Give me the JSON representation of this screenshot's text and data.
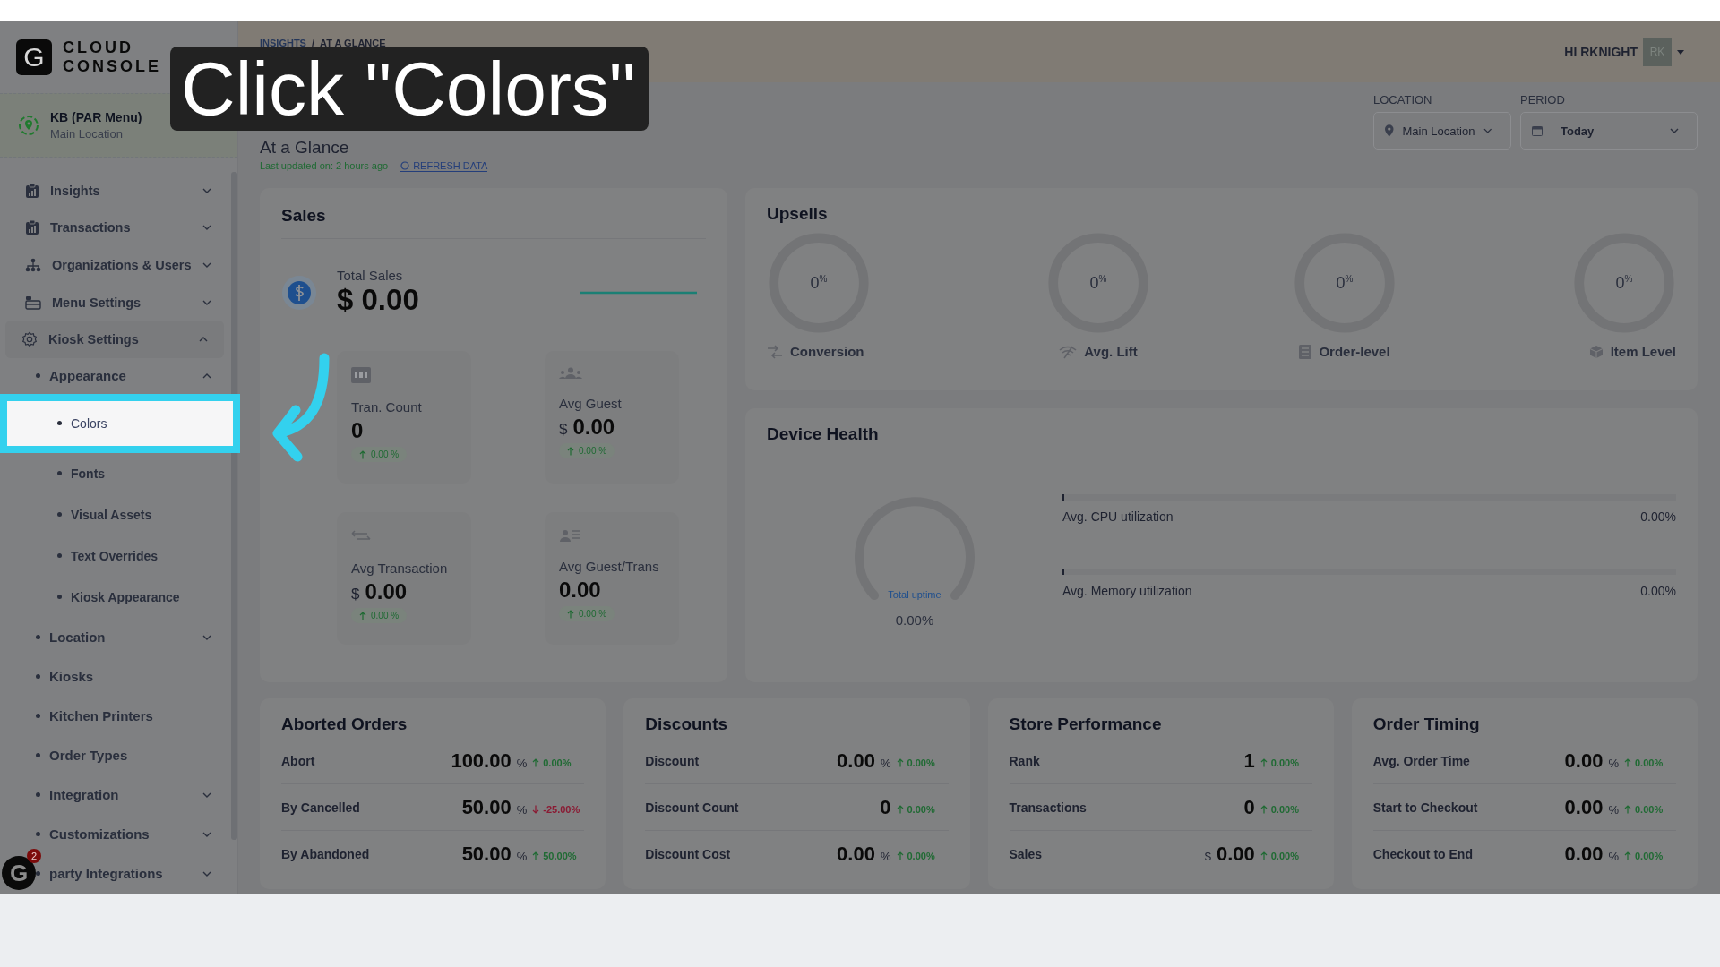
{
  "caption": "Click \"Colors\"",
  "brand": {
    "line1": "CLOUD",
    "line2": "CONSOLE",
    "letter": "G"
  },
  "location_card": {
    "name": "KB (PAR Menu)",
    "subtitle": "Main Location"
  },
  "sidebar": {
    "items": [
      {
        "label": "Insights",
        "expanded": false,
        "selected": false
      },
      {
        "label": "Transactions",
        "expanded": false,
        "selected": false
      },
      {
        "label": "Organizations & Users",
        "expanded": false,
        "selected": false
      },
      {
        "label": "Menu Settings",
        "expanded": false,
        "selected": false
      },
      {
        "label": "Kiosk Settings",
        "expanded": true,
        "selected": false,
        "children": [
          {
            "label": "Appearance",
            "kind": "group",
            "expanded": true,
            "selected": false,
            "children": [
              {
                "label": "Colors",
                "selected": true
              },
              {
                "label": "Fonts",
                "selected": false
              },
              {
                "label": "Visual Assets",
                "selected": false
              },
              {
                "label": "Text Overrides",
                "selected": false
              },
              {
                "label": "Kiosk Appearance",
                "selected": false
              }
            ]
          },
          {
            "label": "Location",
            "kind": "group",
            "expanded": false,
            "selected": false
          },
          {
            "label": "Kiosks",
            "kind": "link",
            "expanded": false,
            "selected": false
          },
          {
            "label": "Kitchen Printers",
            "kind": "link",
            "expanded": false,
            "selected": false
          },
          {
            "label": "Order Types",
            "kind": "link",
            "expanded": false,
            "selected": false
          },
          {
            "label": "Integration",
            "kind": "group",
            "expanded": false,
            "selected": false
          },
          {
            "label": "Customizations",
            "kind": "group",
            "expanded": false,
            "selected": false
          },
          {
            "label": "party Integrations",
            "kind": "group",
            "expanded": false,
            "selected": false
          }
        ]
      }
    ]
  },
  "chat_button": {
    "letter": "G",
    "badge": "2"
  },
  "breadcrumb": {
    "separator": "/",
    "items": [
      "INSIGHTS",
      "AT A GLANCE"
    ]
  },
  "user": {
    "greeting": "HI RKNIGHT",
    "initials": "RK"
  },
  "page": {
    "title": "At a Glance",
    "updated": "Last updated on: 2 hours ago",
    "refresh": "REFRESH DATA"
  },
  "filters": [
    {
      "label": "LOCATION",
      "value": "Main Location"
    },
    {
      "label": "PERIOD",
      "value": "Today"
    }
  ],
  "sales": {
    "title": "Sales",
    "total_label": "Total Sales",
    "total_value": "$ 0.00",
    "metrics": [
      {
        "label": "Tran. Count",
        "value": "0",
        "change": "0.00 %"
      },
      {
        "label": "Avg Guest",
        "prefix": "$",
        "value": "0.00",
        "change": "0.00 %"
      },
      {
        "label": "Avg Transaction",
        "prefix": "$",
        "value": "0.00",
        "change": "0.00 %"
      },
      {
        "label": "Avg Guest/Trans",
        "value": "0.00",
        "change": "0.00 %"
      }
    ]
  },
  "upsells": {
    "title": "Upsells",
    "items": [
      {
        "value": "0$^{%}$",
        "label": "Conversion",
        "level": 0
      },
      {
        "value": "0$^{%}$",
        "label": "Avg. Lift",
        "level": 0
      },
      {
        "value": "0$^{%}$",
        "label": "Order-level",
        "level": 0
      },
      {
        "value": "0$^{%}$",
        "label": "Item Level",
        "level": 0
      }
    ]
  },
  "device_health": {
    "title": "Device Health",
    "uptime_label": "Total uptime",
    "uptime_value": "0.00%",
    "meters": [
      {
        "label": "Avg. CPU utilization",
        "reading": "0.00%",
        "level": 0
      },
      {
        "label": "Avg. Memory utilization",
        "reading": "0.00%",
        "level": 0
      }
    ]
  },
  "stat_cards": [
    {
      "title": "Aborted Orders",
      "rows": [
        {
          "label": "Abort",
          "value": "100.00",
          "unit": "%",
          "negative": false,
          "change": "0.00%"
        },
        {
          "label": "By Cancelled",
          "value": "50.00",
          "unit": "%",
          "negative": true,
          "change": "-25.00%"
        },
        {
          "label": "By Abandoned",
          "value": "50.00",
          "unit": "%",
          "negative": false,
          "change": "50.00%"
        }
      ]
    },
    {
      "title": "Discounts",
      "rows": [
        {
          "label": "Discount",
          "value": "0.00",
          "unit": "%",
          "negative": false,
          "change": "0.00%"
        },
        {
          "label": "Discount Count",
          "value": "0",
          "negative": false,
          "change": "0.00%"
        },
        {
          "label": "Discount Cost",
          "value": "0.00",
          "unit": "%",
          "negative": false,
          "change": "0.00%"
        }
      ]
    },
    {
      "title": "Store Performance",
      "rows": [
        {
          "label": "Rank",
          "value": "1",
          "negative": false,
          "change": "0.00%"
        },
        {
          "label": "Transactions",
          "value": "0",
          "negative": false,
          "change": "0.00%"
        },
        {
          "label": "Sales",
          "prefix": "$",
          "value": "0.00",
          "negative": false,
          "change": "0.00%"
        }
      ]
    },
    {
      "title": "Order Timing",
      "rows": [
        {
          "label": "Avg. Order Time",
          "value": "0.00",
          "unit": "%",
          "negative": false,
          "change": "0.00%"
        },
        {
          "label": "Start to Checkout",
          "value": "0.00",
          "unit": "%",
          "negative": false,
          "change": "0.00%"
        },
        {
          "label": "Checkout to End",
          "value": "0.00",
          "unit": "%",
          "negative": false,
          "change": "0.00%"
        }
      ]
    }
  ]
}
